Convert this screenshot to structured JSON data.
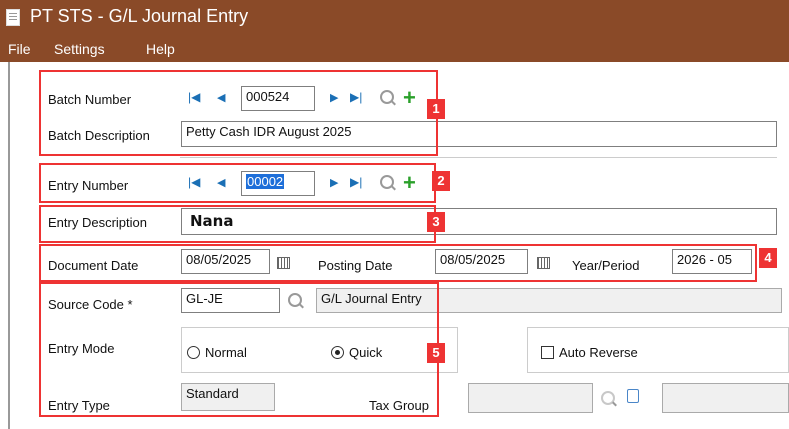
{
  "window": {
    "title": "PT STS  - G/L Journal Entry"
  },
  "menu": [
    "File",
    "Settings",
    "Help"
  ],
  "batch": {
    "number_label": "Batch Number",
    "number_value": "000524",
    "description_label": "Batch Description",
    "description_value": "Petty Cash IDR August 2025"
  },
  "entry": {
    "number_label": "Entry Number",
    "number_value": "00002",
    "description_label": "Entry Description",
    "description_value": "Nana"
  },
  "dates": {
    "document_label": "Document Date",
    "document_value": "08/05/2025",
    "posting_label": "Posting Date",
    "posting_value": "08/05/2025",
    "period_label": "Year/Period",
    "period_value": "2026 - 05"
  },
  "source": {
    "code_label": "Source Code *",
    "code_value": "GL-JE",
    "code_desc": "G/L Journal Entry",
    "mode_label": "Entry Mode",
    "mode_normal": "Normal",
    "mode_quick": "Quick",
    "mode_selected": "Quick",
    "auto_reverse": "Auto Reverse",
    "auto_reverse_checked": false,
    "type_label": "Entry Type",
    "type_value": "Standard",
    "tax_group_label": "Tax Group",
    "tax_group_value": ""
  },
  "annotations": [
    "1",
    "2",
    "3",
    "4",
    "5"
  ],
  "colors": {
    "titlebar": "#8a4a28",
    "annotation": "#ee3333",
    "nav_icon": "#1a6fb5",
    "add_icon": "#2aa02a"
  }
}
